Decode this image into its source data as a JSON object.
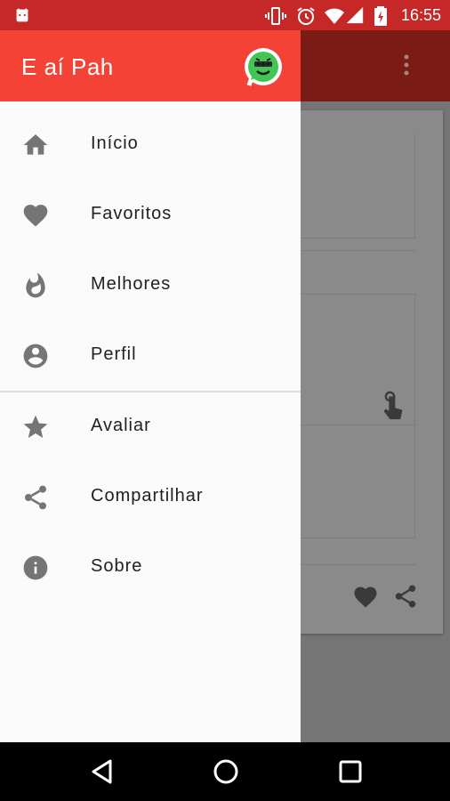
{
  "status_bar": {
    "time": "16:55",
    "icons": [
      "android-icon",
      "vibrate-icon",
      "alarm-icon",
      "wifi-icon",
      "signal-icon",
      "battery-charging-icon"
    ]
  },
  "drawer": {
    "title": "E aí Pah",
    "logo": "whatsapp-logo-icon",
    "header_color": "#f44336",
    "items": [
      {
        "label": "Início",
        "icon": "home-icon"
      },
      {
        "label": "Favoritos",
        "icon": "heart-icon"
      },
      {
        "label": "Melhores",
        "icon": "fire-icon"
      },
      {
        "label": "Perfil",
        "icon": "account-circle-icon"
      },
      {
        "label": "Avaliar",
        "icon": "star-icon"
      },
      {
        "label": "Compartilhar",
        "icon": "share-icon"
      },
      {
        "label": "Sobre",
        "icon": "info-icon"
      }
    ]
  },
  "background": {
    "toolbar_menu_icon": "more-vert-icon",
    "card_icons": [
      "touch-icon",
      "heart-icon",
      "share-icon"
    ]
  },
  "nav_bar": {
    "buttons": [
      "back-icon",
      "home-icon",
      "recents-icon"
    ]
  }
}
